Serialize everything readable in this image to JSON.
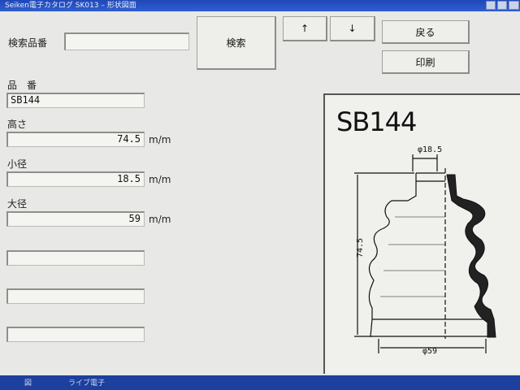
{
  "window": {
    "title": "Seiken電子カタログ SK013 – 形状図面"
  },
  "search": {
    "label": "検索品番",
    "value": "",
    "button_label": "検索"
  },
  "nav": {
    "up_label": "↑",
    "down_label": "↓",
    "back_label": "戻る",
    "print_label": "印刷"
  },
  "fields": {
    "part_number": {
      "label": "品　番",
      "value": "SB144"
    },
    "height": {
      "label": "高さ",
      "value": "74.5",
      "unit": "m/m"
    },
    "small_diameter": {
      "label": "小径",
      "value": "18.5",
      "unit": "m/m"
    },
    "large_diameter": {
      "label": "大径",
      "value": "59",
      "unit": "m/m"
    },
    "blank": [
      "",
      "",
      ""
    ]
  },
  "drawing": {
    "part_number": "SB144",
    "small_dia_text": "φ18.5",
    "height_text": "74.5",
    "large_dia_text": "φ59"
  },
  "taskbar": {
    "items": [
      "図",
      "ライブ電子"
    ]
  }
}
